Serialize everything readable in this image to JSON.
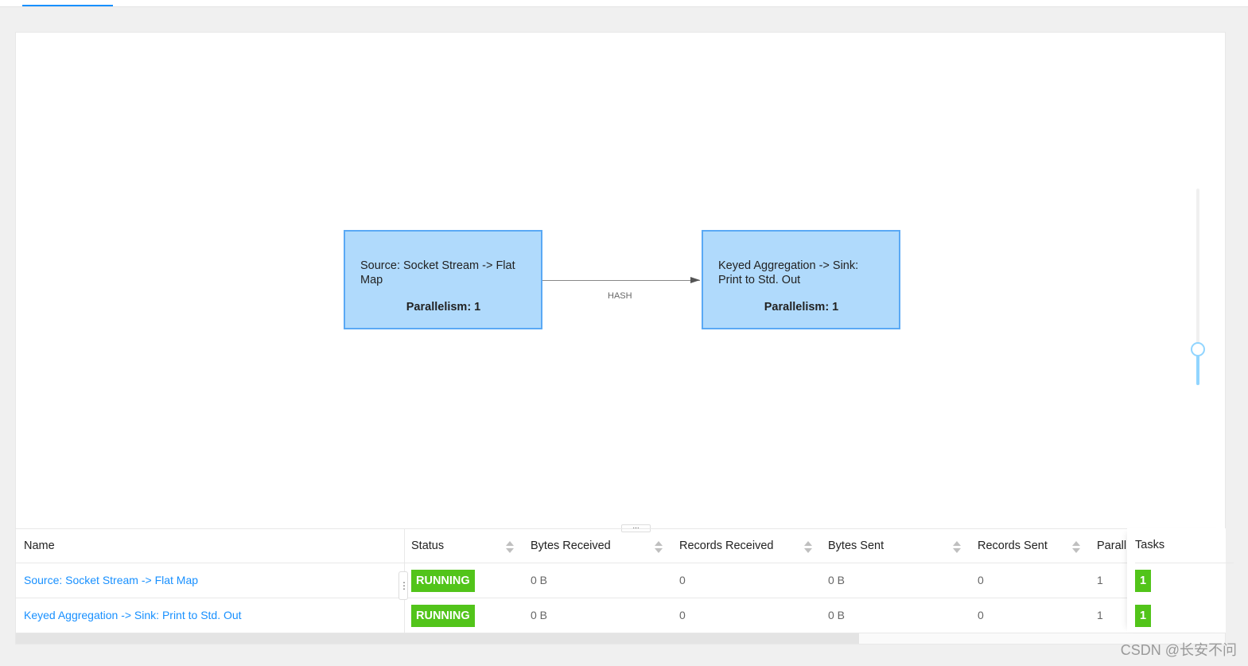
{
  "graph": {
    "nodes": [
      {
        "label": "Source: Socket Stream -> Flat Map",
        "parallelism": "Parallelism: 1"
      },
      {
        "label": "Keyed Aggregation -> Sink: Print to Std. Out",
        "parallelism": "Parallelism: 1"
      }
    ],
    "edge_label": "HASH",
    "zoom_slider_value_percent": 18,
    "colors": {
      "node_fill": "#b0dafc",
      "node_border": "#5aa9f5",
      "slider": "#91d5ff"
    }
  },
  "splitter_label": "...",
  "table": {
    "columns": [
      "Name",
      "Status",
      "Bytes Received",
      "Records Received",
      "Bytes Sent",
      "Records Sent",
      "Parall",
      "Tasks"
    ],
    "rows": [
      {
        "name": "Source: Socket Stream -> Flat Map",
        "status": "RUNNING",
        "bytes_received": "0 B",
        "records_received": "0",
        "bytes_sent": "0 B",
        "records_sent": "0",
        "parallelism": "1",
        "tasks": "1"
      },
      {
        "name": "Keyed Aggregation -> Sink: Print to Std. Out",
        "status": "RUNNING",
        "bytes_received": "0 B",
        "records_received": "0",
        "bytes_sent": "0 B",
        "records_sent": "0",
        "parallelism": "1",
        "tasks": "1"
      }
    ],
    "colors": {
      "running": "#52c41a",
      "link": "#1890ff"
    }
  },
  "watermark": "CSDN @长安不问"
}
